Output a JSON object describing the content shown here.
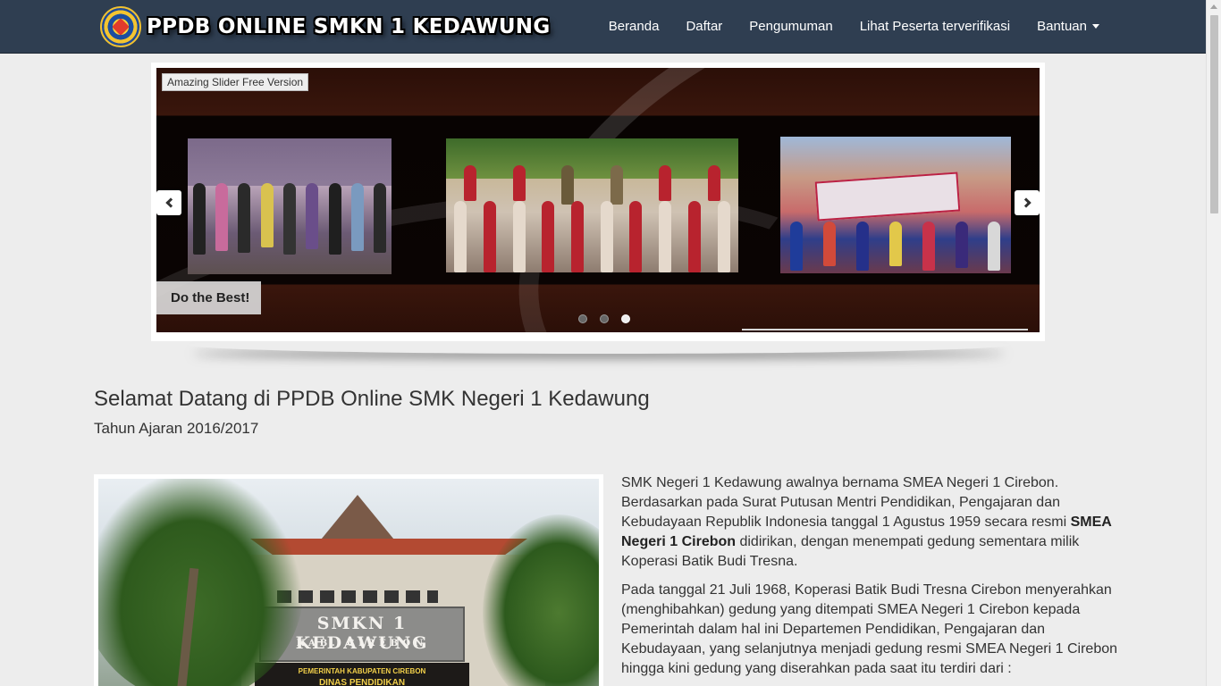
{
  "brand": {
    "title": "PPDB ONLINE SMKN 1 KEDAWUNG",
    "logo": "school-emblem"
  },
  "nav": {
    "items": [
      {
        "label": "Beranda"
      },
      {
        "label": "Daftar"
      },
      {
        "label": "Pengumuman"
      },
      {
        "label": "Lihat Peserta terverifikasi"
      },
      {
        "label": "Bantuan",
        "has_dropdown": true
      }
    ]
  },
  "slider": {
    "watermark": "Amazing Slider Free Version",
    "caption": "Do the Best!",
    "slide_count": 3,
    "active_slide": 3,
    "prev_icon": "chevron-left-icon",
    "next_icon": "chevron-right-icon"
  },
  "main": {
    "title": "Selamat Datang di PPDB Online SMK Negeri 1 Kedawung",
    "subtitle": "Tahun Ajaran 2016/2017",
    "photo": {
      "sign_main": "SMKN 1 KEDAWUNG",
      "sign_sub": "KAB. CIREBON",
      "plaque_line1": "PEMERINTAH KABUPATEN CIREBON",
      "plaque_line2": "DINAS PENDIDIKAN"
    },
    "paragraph1_before": "SMK Negeri 1 Kedawung awalnya bernama SMEA Negeri 1 Cirebon. Berdasarkan pada Surat Putusan Mentri Pendidikan, Pengajaran dan Kebudayaan Republik Indonesia tanggal 1 Agustus 1959 secara resmi ",
    "paragraph1_bold": "SMEA Negeri 1 Cirebon",
    "paragraph1_after": " didirikan, dengan menempati gedung sementara milik Koperasi Batik Budi Tresna.",
    "paragraph2": "Pada tanggal 21 Juli 1968, Koperasi Batik Budi Tresna Cirebon menyerahkan (menghibahkan) gedung yang ditempati SMEA Negeri 1 Cirebon kepada Pemerintah dalam hal ini Departemen Pendidikan, Pengajaran dan Kebudayaan, yang selanjutnya menjadi gedung resmi SMEA Negeri 1 Cirebon hingga kini gedung yang diserahkan pada saat itu terdiri dari :"
  },
  "colors": {
    "navbar": "#2f3e51",
    "background": "#ededed",
    "text": "#333333"
  }
}
